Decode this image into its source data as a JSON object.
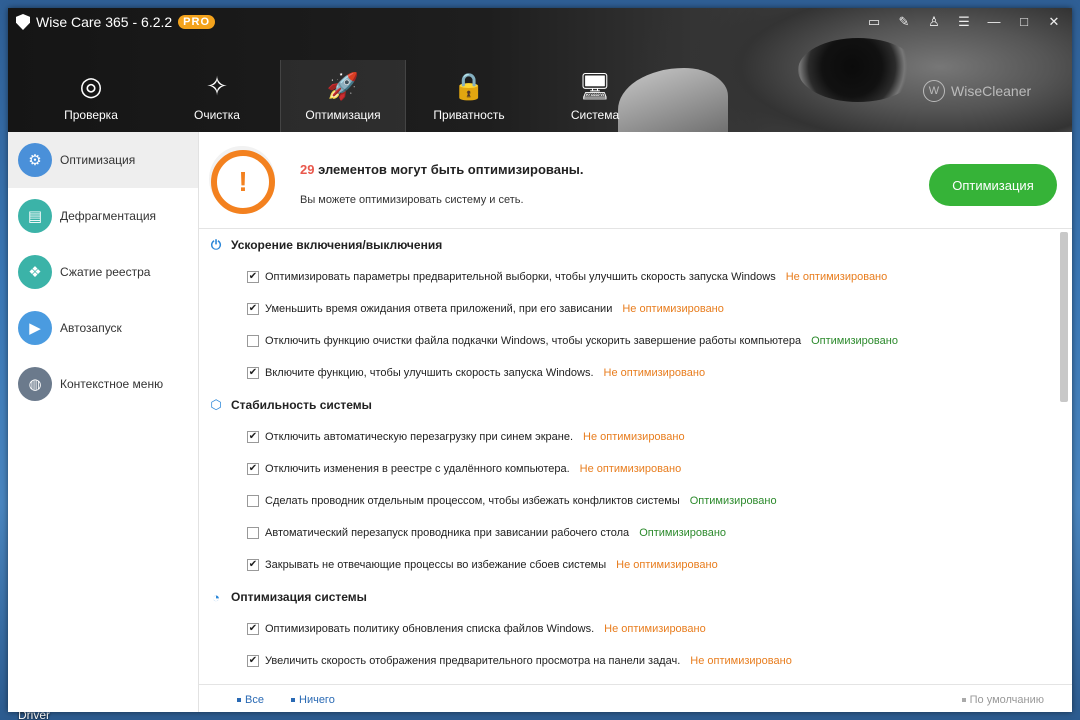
{
  "app": {
    "title": "Wise Care 365 - 6.2.2",
    "badge": "PRO",
    "brand": "WiseCleaner",
    "brand_logo": "W"
  },
  "window_controls": {
    "feedback_icon": "▭",
    "edit_icon": "✎",
    "shirt_icon": "♙",
    "menu_icon": "☰",
    "minimize_icon": "—",
    "maximize_icon": "□",
    "close_icon": "✕"
  },
  "nav": [
    {
      "label": "Проверка",
      "icon": "◎"
    },
    {
      "label": "Очистка",
      "icon": "✧"
    },
    {
      "label": "Оптимизация",
      "icon": "🚀"
    },
    {
      "label": "Приватность",
      "icon": "🔒"
    },
    {
      "label": "Система",
      "icon": "🖥"
    }
  ],
  "sidebar": [
    {
      "label": "Оптимизация",
      "icon": "⚙",
      "color": "#4a90d9"
    },
    {
      "label": "Дефрагментация",
      "icon": "▤",
      "color": "#3bb3a8"
    },
    {
      "label": "Сжатие реестра",
      "icon": "❖",
      "color": "#3bb3a8"
    },
    {
      "label": "Автозапуск",
      "icon": "▶",
      "color": "#4a9be0"
    },
    {
      "label": "Контекстное меню",
      "icon": "◍",
      "color": "#6b7a8c"
    }
  ],
  "banner": {
    "count": "29",
    "title": "элементов могут быть оптимизированы.",
    "subtitle": "Вы можете оптимизировать систему и сеть.",
    "button": "Оптимизация",
    "warn_icon": "!"
  },
  "sections": [
    {
      "title": "Ускорение включения/выключения",
      "icon": "⏻",
      "items": [
        {
          "text": "Оптимизировать параметры предварительной выборки, чтобы улучшить скорость запуска Windows",
          "checked": true,
          "status": "Не оптимизировано"
        },
        {
          "text": "Уменьшить время ожидания ответа приложений, при его зависании",
          "checked": true,
          "status": "Не оптимизировано"
        },
        {
          "text": "Отключить функцию очистки файла подкачки Windows, чтобы ускорить завершение работы компьютера",
          "checked": false,
          "status": "Оптимизировано"
        },
        {
          "text": "Включите функцию, чтобы улучшить скорость запуска Windows.",
          "checked": true,
          "status": "Не оптимизировано"
        }
      ]
    },
    {
      "title": "Стабильность системы",
      "icon": "⬡",
      "items": [
        {
          "text": "Отключить автоматическую перезагрузку при синем экране.",
          "checked": true,
          "status": "Не оптимизировано"
        },
        {
          "text": "Отключить изменения в реестре с удалённого компьютера.",
          "checked": true,
          "status": "Не оптимизировано"
        },
        {
          "text": "Сделать проводник отдельным процессом, чтобы избежать конфликтов системы",
          "checked": false,
          "status": "Оптимизировано"
        },
        {
          "text": "Автоматический перезапуск проводника при зависании рабочего стола",
          "checked": false,
          "status": "Оптимизировано"
        },
        {
          "text": "Закрывать не отвечающие процессы во избежание сбоев системы",
          "checked": true,
          "status": "Не оптимизировано"
        }
      ]
    },
    {
      "title": "Оптимизация системы",
      "icon": "◔",
      "items": [
        {
          "text": "Оптимизировать политику обновления списка файлов Windows.",
          "checked": true,
          "status": "Не оптимизировано"
        },
        {
          "text": "Увеличить скорость отображения предварительного просмотра на панели задач.",
          "checked": true,
          "status": "Не оптимизировано"
        }
      ]
    }
  ],
  "footer": {
    "all": "Все",
    "none": "Ничего",
    "default": "По умолчанию"
  },
  "desktop": {
    "label": "Driver"
  },
  "colors": {
    "accent_green": "#36b338",
    "warn_orange": "#f3811f",
    "status_not": "#e87d1e",
    "status_ok": "#2c8a2c",
    "count_red": "#e9584c"
  }
}
